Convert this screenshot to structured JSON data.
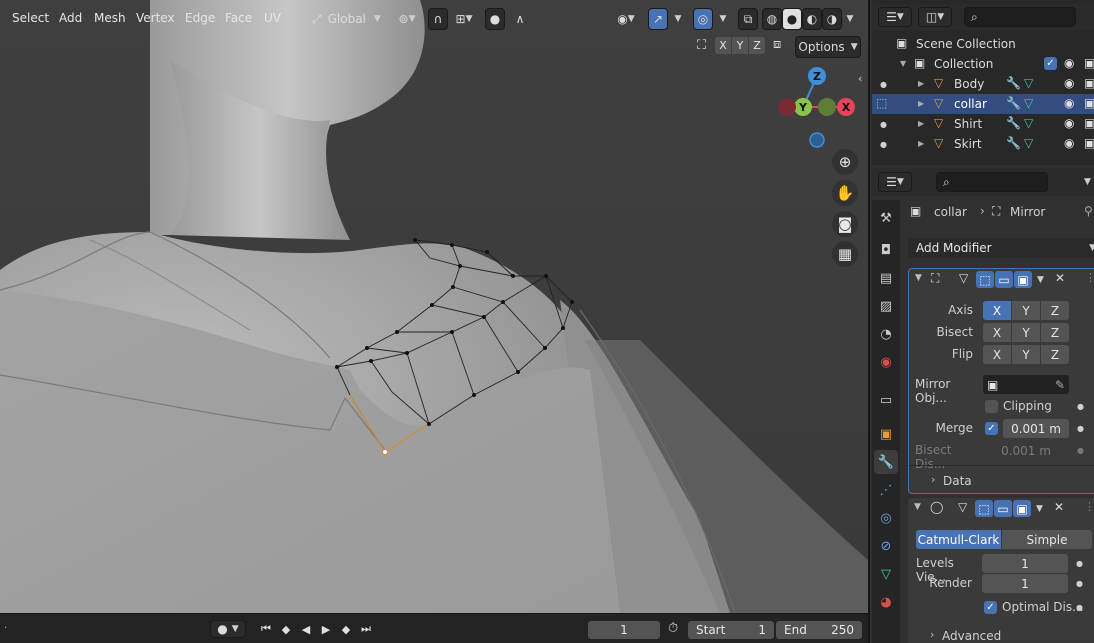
{
  "viewport": {
    "menu": [
      "Select",
      "Add",
      "Mesh",
      "Vertex",
      "Edge",
      "Face",
      "UV"
    ],
    "orientation": "Global",
    "options_label": "Options",
    "mirror_axes": [
      "X",
      "Y",
      "Z"
    ]
  },
  "gizmo": {
    "x": "X",
    "y": "Y",
    "z": "Z"
  },
  "timeline": {
    "current_frame": "1",
    "start_label": "Start",
    "start_value": "1",
    "end_label": "End",
    "end_value": "250"
  },
  "outliner": {
    "scene_collection": "Scene Collection",
    "collection": "Collection",
    "objects": [
      {
        "name": "Body",
        "selected": false
      },
      {
        "name": "collar",
        "selected": true
      },
      {
        "name": "Shirt",
        "selected": false
      },
      {
        "name": "Skirt",
        "selected": false
      }
    ]
  },
  "properties": {
    "breadcrumb_object": "collar",
    "breadcrumb_modifier": "Mirror",
    "add_modifier": "Add Modifier",
    "mirror": {
      "axis_label": "Axis",
      "bisect_label": "Bisect",
      "flip_label": "Flip",
      "axes": [
        "X",
        "Y",
        "Z"
      ],
      "mirror_object_label": "Mirror Obj...",
      "clipping_label": "Clipping",
      "merge_label": "Merge",
      "merge_value": "0.001 m",
      "bisect_distance_label": "Bisect Dis...",
      "bisect_distance_value": "0.001 m",
      "data_label": "Data"
    },
    "subsurf": {
      "catmull_label": "Catmull-Clark",
      "simple_label": "Simple",
      "levels_viewport_label": "Levels Vie...",
      "levels_viewport_value": "1",
      "render_label": "Render",
      "render_value": "1",
      "optimal_display_label": "Optimal Dis...",
      "advanced_label": "Advanced"
    }
  },
  "colors": {
    "accent": "#4772b3",
    "axis_x": "#e8445c",
    "axis_y": "#8bc34a",
    "axis_z": "#3f8fdd"
  }
}
